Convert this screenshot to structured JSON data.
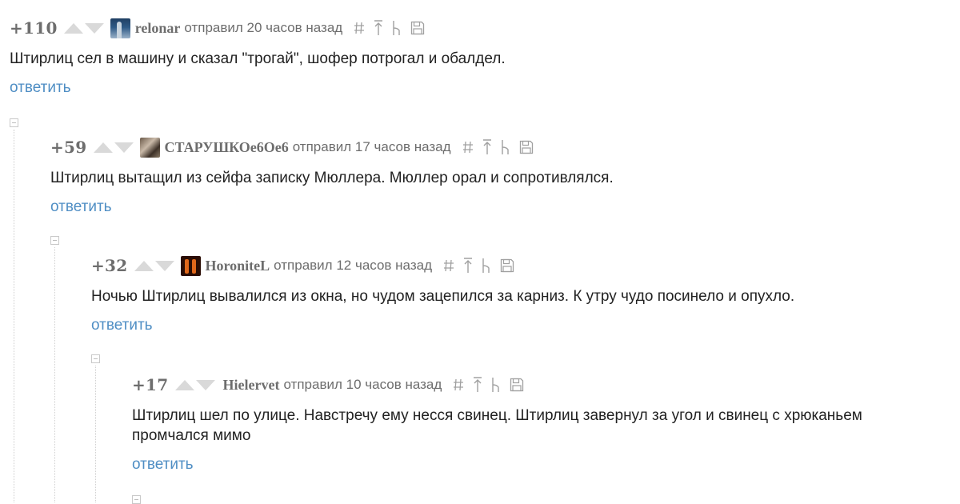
{
  "comments": [
    {
      "rating": "+110",
      "username": "relonar",
      "sent": "отправил 20 часов назад",
      "text": "Штирлиц сел в машину и сказал \"трогай\", шофер потрогал и обалдел.",
      "reply": "ответить"
    },
    {
      "rating": "+59",
      "username": "СТАРУШКОе6Ое6",
      "sent": "отправил 17 часов назад",
      "text": "Штирлиц вытащил из сейфа записку Мюллера. Мюллер орал и сопротивлялся.",
      "reply": "ответить"
    },
    {
      "rating": "+32",
      "username": "HoroniteL",
      "sent": "отправил 12 часов назад",
      "text": "Ночью Штирлиц вывалился из окна, но чудом зацепился за карниз. К утру чудо посинело и опухло.",
      "reply": "ответить"
    },
    {
      "rating": "+17",
      "username": "Hielervet",
      "sent": "отправил 10 часов назад",
      "text_line1": "Штирлиц шел по улице. Навстречу ему несся свинец. Штирлиц завернул за угол и свинец с хрюканьем",
      "text_line2": "промчался мимо",
      "reply": "ответить"
    }
  ],
  "icons": [
    "hash-icon",
    "arrow-up-icon",
    "branch-icon",
    "save-icon"
  ],
  "colors": {
    "text": "#222222",
    "meta": "#6d6d6d",
    "link": "#4f8ec4",
    "vote_arrow": "#d9d9d9",
    "icon": "#9a9a9a"
  }
}
